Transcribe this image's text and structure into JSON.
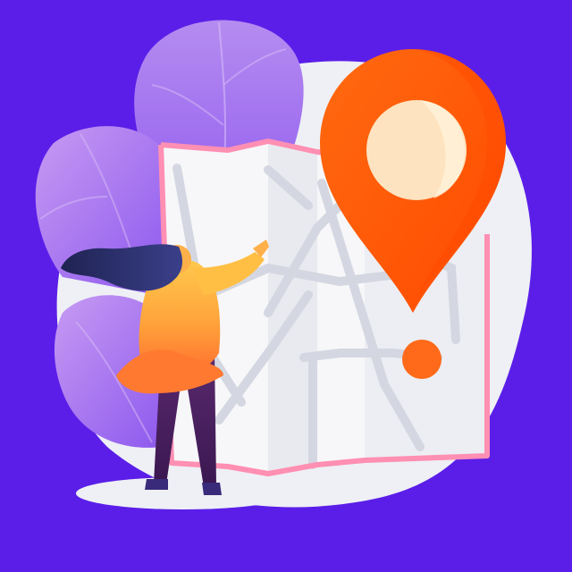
{
  "scene": {
    "subject": "woman-reading-map-with-location-pin",
    "colors": {
      "background": "#5b1ee8",
      "backdrop_blob": "#eef0f5",
      "leaf_light": "#b58cf0",
      "leaf_dark": "#8e5ef0",
      "map_paper": "#f7f7f9",
      "map_shade": "#e9eaef",
      "map_roads": "#d4d7e1",
      "map_border": "#ff8fb3",
      "pin_orange": "#ff5a00",
      "pin_inner": "#fde3bf",
      "hair": "#262a5c",
      "shirt_top": "#ffc94d",
      "shirt_bottom": "#ff6a2e",
      "pants": "#4a1f5e"
    },
    "icons": [
      "map-icon",
      "location-pin-icon"
    ]
  }
}
